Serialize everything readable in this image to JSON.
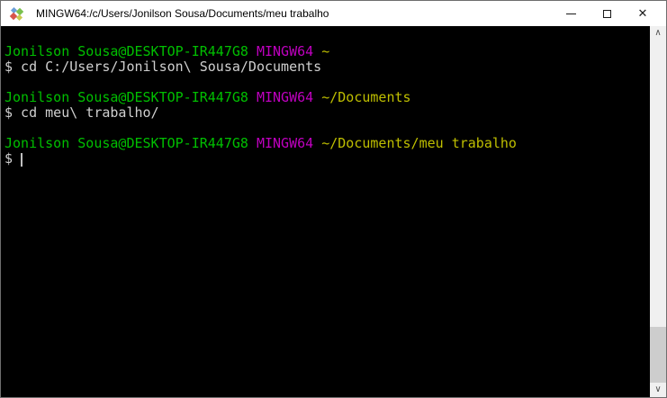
{
  "window": {
    "title": "MINGW64:/c/Users/Jonilson Sousa/Documents/meu trabalho",
    "controls": {
      "minimize": "minimize-icon",
      "maximize": "maximize-icon",
      "close": "close-icon",
      "close_glyph": "✕"
    },
    "app_icon": "msys2-diamond-icon"
  },
  "terminal": {
    "colors": {
      "background": "#000000",
      "foreground": "#cfcfcf",
      "green": "#00bf00",
      "magenta": "#bf00bf",
      "yellow": "#bfbf00"
    },
    "scrollbar": {
      "up_icon": "∧",
      "down_icon": "∨"
    },
    "blocks": [
      {
        "user_host": "Jonilson Sousa@DESKTOP-IR447G8",
        "msystem": "MINGW64",
        "path": "~",
        "command": "$ cd C:/Users/Jonilson\\ Sousa/Documents"
      },
      {
        "user_host": "Jonilson Sousa@DESKTOP-IR447G8",
        "msystem": "MINGW64",
        "path": "~/Documents",
        "command": "$ cd meu\\ trabalho/"
      },
      {
        "user_host": "Jonilson Sousa@DESKTOP-IR447G8",
        "msystem": "MINGW64",
        "path": "~/Documents/meu trabalho",
        "command": "$"
      }
    ]
  }
}
